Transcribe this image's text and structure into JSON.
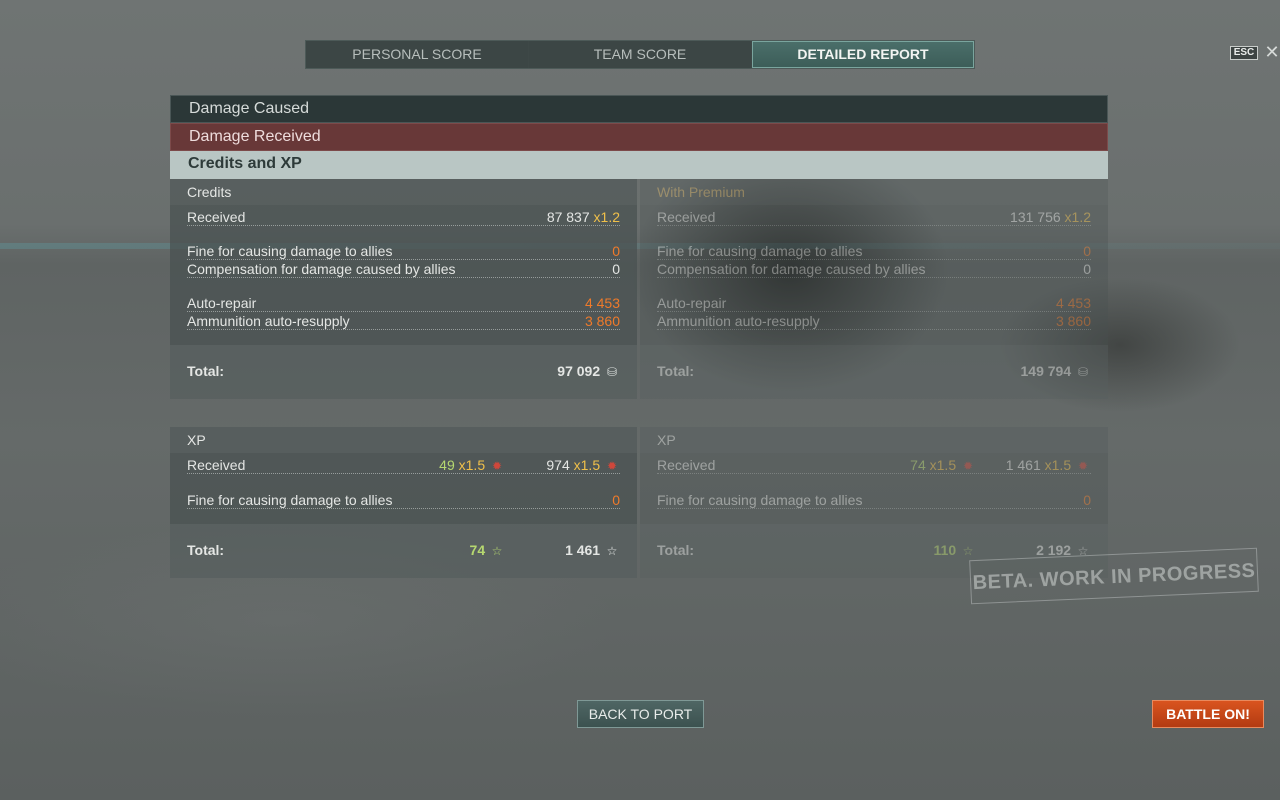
{
  "tabs": [
    {
      "label": "PERSONAL SCORE",
      "active": false
    },
    {
      "label": "TEAM SCORE",
      "active": false
    },
    {
      "label": "DETAILED REPORT",
      "active": true
    }
  ],
  "esc_label": "ESC",
  "close_icon": "close-icon",
  "sections": {
    "damage_caused": "Damage Caused",
    "damage_received": "Damage Received",
    "credits_xp": "Credits and XP"
  },
  "credits": {
    "standard": {
      "title": "Credits",
      "received_label": "Received",
      "received_value": "87 837",
      "received_mult": "x1.2",
      "fine_label": "Fine for causing damage to allies",
      "fine_value": "0",
      "comp_label": "Compensation for damage caused by allies",
      "comp_value": "0",
      "repair_label": "Auto-repair",
      "repair_value": "4 453",
      "ammo_label": "Ammunition auto-resupply",
      "ammo_value": "3 860",
      "total_label": "Total:",
      "total_value": "97 092",
      "total_icon": "credits-icon"
    },
    "premium": {
      "title": "With Premium",
      "received_label": "Received",
      "received_value": "131 756",
      "received_mult": "x1.2",
      "fine_label": "Fine for causing damage to allies",
      "fine_value": "0",
      "comp_label": "Compensation for damage caused by allies",
      "comp_value": "0",
      "repair_label": "Auto-repair",
      "repair_value": "4 453",
      "ammo_label": "Ammunition auto-resupply",
      "ammo_value": "3 860",
      "total_label": "Total:",
      "total_value": "149 794",
      "total_icon": "credits-icon"
    }
  },
  "xp": {
    "standard": {
      "title": "XP",
      "received_label": "Received",
      "received_xp": "49",
      "received_xp_mult": "x1.5",
      "received_free": "974",
      "received_free_mult": "x1.5",
      "fine_label": "Fine for causing damage to allies",
      "fine_value": "0",
      "total_label": "Total:",
      "total_xp": "74",
      "total_free": "1 461"
    },
    "premium": {
      "title": "XP",
      "received_label": "Received",
      "received_xp": "74",
      "received_xp_mult": "x1.5",
      "received_free": "1 461",
      "received_free_mult": "x1.5",
      "fine_label": "Fine for causing damage to allies",
      "fine_value": "0",
      "total_label": "Total:",
      "total_xp": "110",
      "total_free": "2 192"
    }
  },
  "watermark": "BETA. WORK IN PROGRESS",
  "buttons": {
    "back_to_port": "BACK TO PORT",
    "battle_on": "BATTLE ON!"
  },
  "colors": {
    "accent_orange": "#ef7a2a",
    "multiplier_yellow": "#f0c04a",
    "xp_green": "#b6d870",
    "battle_button": "#c8461a",
    "tab_active": "#45655f"
  }
}
